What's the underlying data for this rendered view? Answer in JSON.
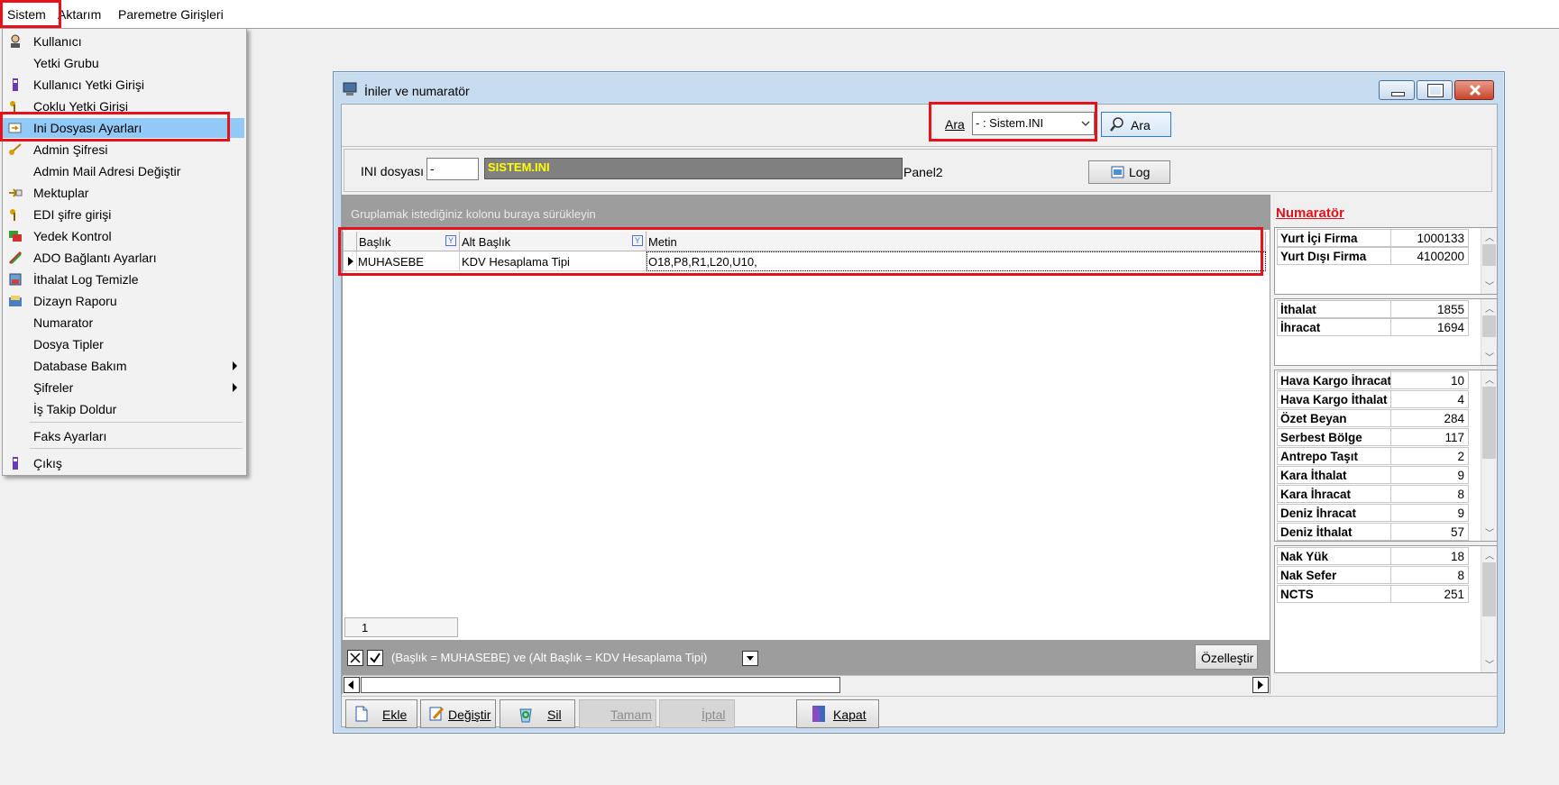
{
  "menubar": {
    "items": [
      "Sistem",
      "Aktarım",
      "Paremetre Girişleri"
    ]
  },
  "menu": {
    "items": [
      {
        "label": "Kullanıcı",
        "icon": "user-icon"
      },
      {
        "label": "Yetki Grubu",
        "icon": ""
      },
      {
        "label": "Kullanıcı Yetki Girişi",
        "icon": "user-key-icon"
      },
      {
        "label": "Çoklu Yetki Girişi",
        "icon": "multi-key-icon"
      },
      {
        "label": "Ini Dosyası  Ayarları",
        "icon": "settings-file-icon"
      },
      {
        "label": "Admin Şifresi",
        "icon": "key-icon"
      },
      {
        "label": "Admin Mail Adresi Değiştir",
        "icon": ""
      },
      {
        "label": "Mektuplar",
        "icon": "letter-icon"
      },
      {
        "label": "EDI şifre girişi",
        "icon": "key-icon"
      },
      {
        "label": "Yedek Kontrol",
        "icon": "backup-icon"
      },
      {
        "label": "ADO Bağlantı Ayarları",
        "icon": "connection-icon"
      },
      {
        "label": "İthalat Log Temizle",
        "icon": "log-clean-icon"
      },
      {
        "label": "Dizayn Raporu",
        "icon": "report-icon"
      },
      {
        "label": "Numarator",
        "icon": ""
      },
      {
        "label": "Dosya Tipler",
        "icon": ""
      },
      {
        "label": "Database Bakım",
        "icon": ""
      },
      {
        "label": "Şifreler",
        "icon": ""
      },
      {
        "label": "İş Takip Doldur",
        "icon": ""
      },
      {
        "label": "Faks Ayarları",
        "icon": ""
      },
      {
        "label": "Çıkış",
        "icon": "exit-icon"
      }
    ]
  },
  "window": {
    "title": "İniler ve numaratör",
    "search_label": "Ara",
    "search_value": "- : Sistem.INI",
    "search_button": "Ara",
    "ini_label": "INI dosyası",
    "ini_code": "-",
    "ini_name": "SISTEM.INI",
    "panel_label": "Panel2",
    "log_button": "Log"
  },
  "grid": {
    "group_hint": "Gruplamak istediğiniz kolonu buraya sürükleyin",
    "columns": [
      "Başlık",
      "Alt Başlık",
      "Metin"
    ],
    "rows": [
      {
        "baslik": "MUHASEBE",
        "alt_baslik": "KDV Hesaplama Tipi",
        "metin": "O18,P8,R1,L20,U10,"
      }
    ],
    "record_count": "1",
    "filter_text": "(Başlık = MUHASEBE) ve (Alt Başlık = KDV Hesaplama Tipi)",
    "customize_button": "Özelleştir"
  },
  "numarator": {
    "title": "Numaratör",
    "groups": [
      [
        {
          "label": "Yurt İçi Firma",
          "value": "1000133"
        },
        {
          "label": "Yurt Dışı Firma",
          "value": "4100200"
        }
      ],
      [
        {
          "label": "İthalat",
          "value": "1855"
        },
        {
          "label": "İhracat",
          "value": "1694"
        }
      ],
      [
        {
          "label": "Hava Kargo İhracat",
          "value": "10"
        },
        {
          "label": "Hava Kargo İthalat",
          "value": "4"
        },
        {
          "label": "Özet Beyan",
          "value": "284"
        },
        {
          "label": "Serbest Bölge",
          "value": "117"
        },
        {
          "label": "Antrepo Taşıt",
          "value": "2"
        },
        {
          "label": "Kara İthalat",
          "value": "9"
        },
        {
          "label": "Kara İhracat",
          "value": "8"
        },
        {
          "label": "Deniz İhracat",
          "value": "9"
        },
        {
          "label": "Deniz İthalat",
          "value": "57"
        }
      ],
      [
        {
          "label": "Nak Yük",
          "value": "18"
        },
        {
          "label": "Nak Sefer",
          "value": "8"
        },
        {
          "label": "NCTS",
          "value": "251"
        }
      ]
    ]
  },
  "buttons": {
    "ekle": "Ekle",
    "degistir": "Değiştir",
    "sil": "Sil",
    "tamam": "Tamam",
    "iptal": "İptal",
    "kapat": "Kapat"
  },
  "colors": {
    "highlight": "#e8101a",
    "menu_selected": "#91c9f7",
    "ini_name_fg": "#ffff00",
    "ini_name_bg": "#808080",
    "numarator_title": "#e8101a"
  }
}
